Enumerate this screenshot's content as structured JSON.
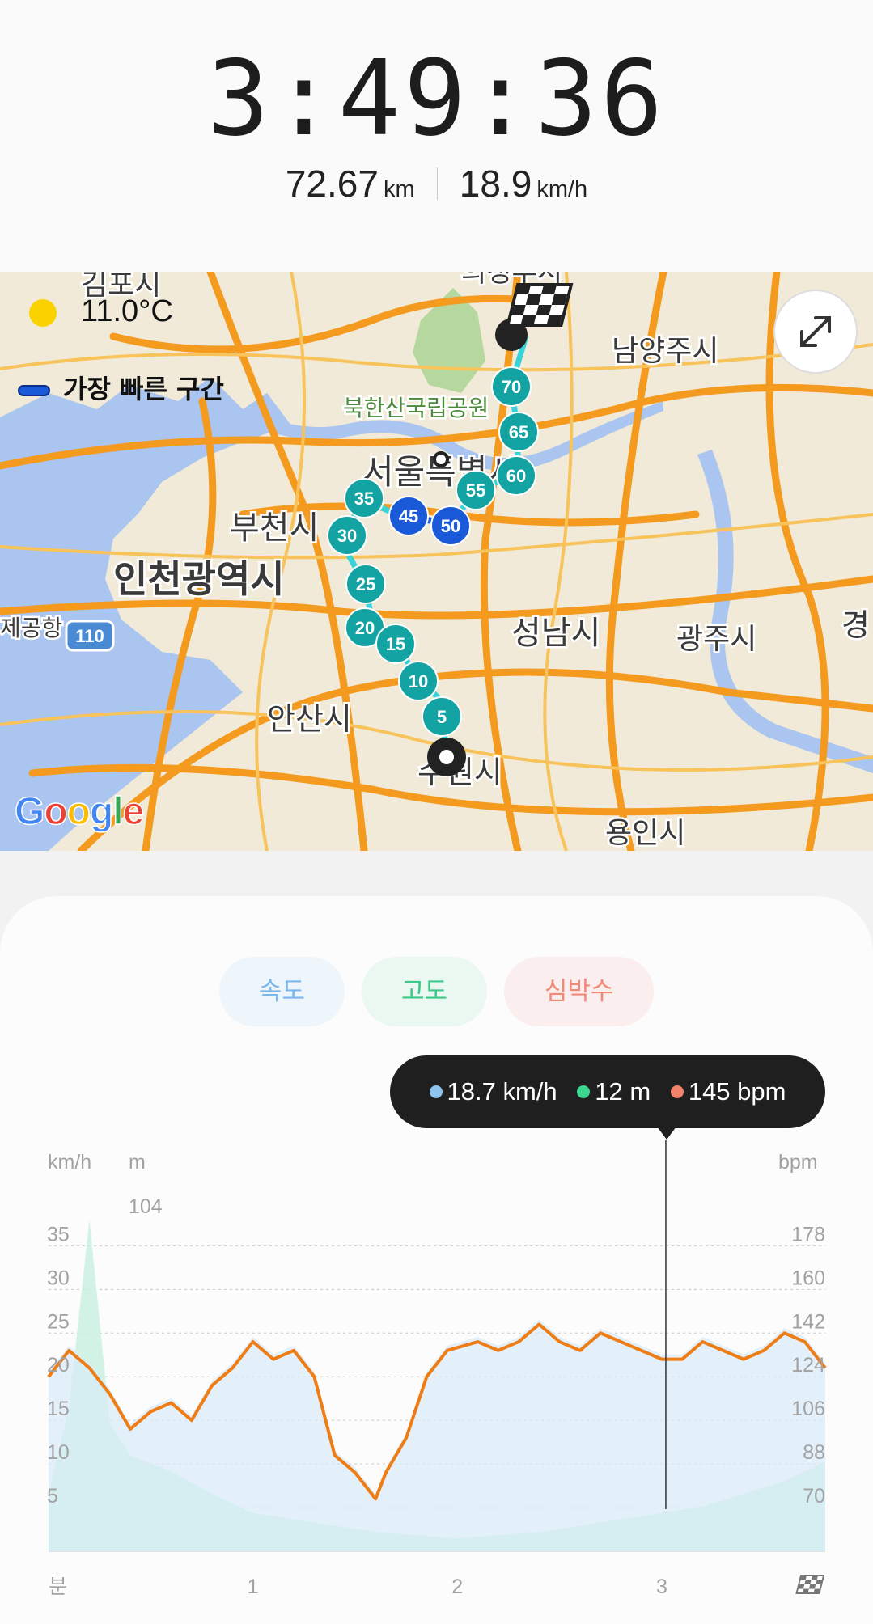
{
  "summary": {
    "duration": "3:49:36",
    "distance_value": "72.67",
    "distance_unit": "km",
    "speed_value": "18.9",
    "speed_unit": "km/h"
  },
  "map": {
    "weather": "11.0°C",
    "legend_label": "가장 빠른 구간",
    "places": [
      "김포시",
      "의정부시",
      "남양주시",
      "북한산국립공원",
      "서울특별시",
      "부천시",
      "인천광역시",
      "성남시",
      "광주시",
      "안산시",
      "수원시",
      "용인시",
      "제공항",
      "경",
      "110"
    ],
    "markers": [
      "70",
      "65",
      "60",
      "55",
      "50",
      "45",
      "35",
      "30",
      "25",
      "20",
      "15",
      "10",
      "5"
    ],
    "fast_markers": [
      "45",
      "50"
    ],
    "attribution": "Google"
  },
  "tabs": {
    "speed": "속도",
    "altitude": "고도",
    "heart_rate": "심박수"
  },
  "tooltip": {
    "speed": "18.7 km/h",
    "altitude": "12 m",
    "heart_rate": "145 bpm"
  },
  "chart_data": {
    "type": "line",
    "x_label": "분",
    "x_ticks": [
      "1",
      "2",
      "3"
    ],
    "x_range": [
      0,
      3.8
    ],
    "left_units": {
      "speed": "km/h",
      "altitude": "m"
    },
    "right_unit": "bpm",
    "speed_ticks": [
      "35",
      "30",
      "25",
      "20",
      "15",
      "10",
      "5"
    ],
    "altitude_tick": "104",
    "bpm_ticks": [
      "178",
      "160",
      "142",
      "124",
      "106",
      "88",
      "70"
    ],
    "speed_range": [
      0,
      38
    ],
    "cursor_x": 3.02,
    "series": [
      {
        "name": "속도",
        "unit": "km/h",
        "x": [
          0,
          0.1,
          0.2,
          0.3,
          0.4,
          0.5,
          0.6,
          0.7,
          0.8,
          0.9,
          1.0,
          1.1,
          1.2,
          1.3,
          1.4,
          1.5,
          1.6,
          1.65,
          1.75,
          1.85,
          1.95,
          2.1,
          2.2,
          2.3,
          2.4,
          2.5,
          2.6,
          2.7,
          2.8,
          2.9,
          3.0,
          3.1,
          3.2,
          3.3,
          3.4,
          3.5,
          3.6,
          3.7,
          3.8
        ],
        "values": [
          20,
          23,
          21,
          18,
          14,
          16,
          17,
          15,
          19,
          21,
          24,
          22,
          23,
          20,
          11,
          9,
          6,
          9,
          13,
          20,
          23,
          24,
          23,
          24,
          26,
          24,
          23,
          25,
          24,
          23,
          22,
          22,
          24,
          23,
          22,
          23,
          25,
          24,
          21
        ]
      },
      {
        "name": "고도",
        "unit": "m",
        "x": [
          0,
          0.1,
          0.2,
          0.3,
          0.4,
          0.6,
          0.8,
          1.0,
          1.2,
          1.4,
          1.6,
          1.8,
          2.0,
          2.2,
          2.4,
          2.6,
          2.8,
          3.0,
          3.2,
          3.4,
          3.6,
          3.8
        ],
        "values": [
          18,
          45,
          104,
          40,
          30,
          25,
          18,
          12,
          10,
          8,
          6,
          5,
          4,
          5,
          6,
          8,
          10,
          12,
          14,
          18,
          22,
          28
        ]
      }
    ]
  }
}
